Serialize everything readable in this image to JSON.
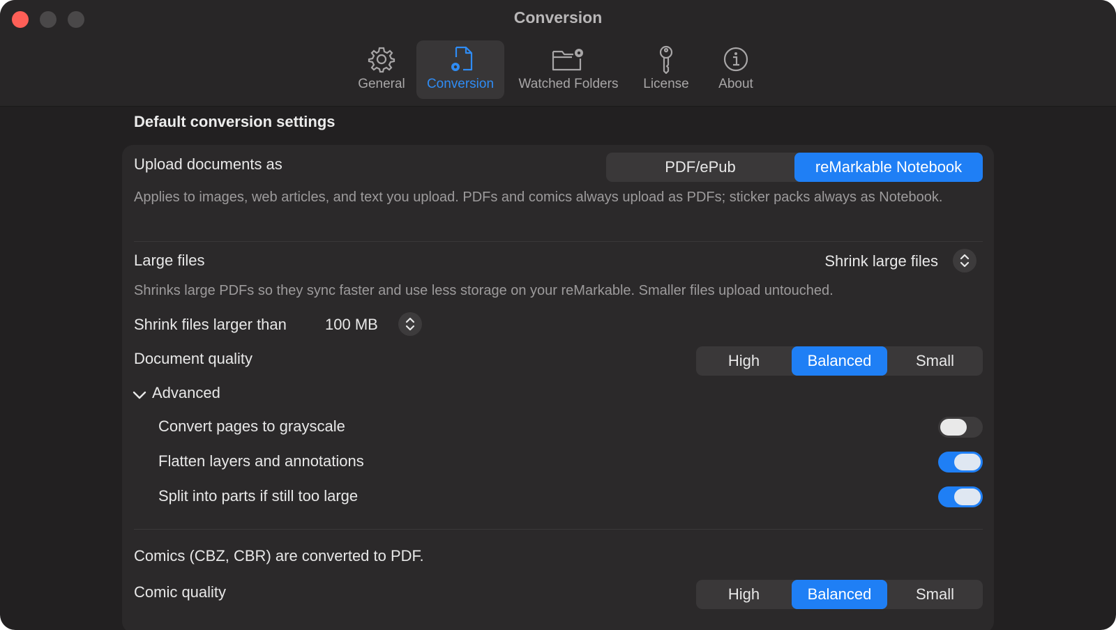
{
  "window": {
    "title": "Conversion"
  },
  "tabs": [
    {
      "label": "General",
      "icon": "gear-icon",
      "active": false
    },
    {
      "label": "Conversion",
      "icon": "document-gear-icon",
      "active": true
    },
    {
      "label": "Watched Folders",
      "icon": "folder-gear-icon",
      "active": false
    },
    {
      "label": "License",
      "icon": "key-icon",
      "active": false
    },
    {
      "label": "About",
      "icon": "info-icon",
      "active": false
    }
  ],
  "section_title": "Default conversion settings",
  "upload": {
    "label": "Upload documents as",
    "options": [
      "PDF/ePub",
      "reMarkable Notebook"
    ],
    "selected": "reMarkable Notebook",
    "description": "Applies to images, web articles, and text you upload. PDFs and comics always upload as PDFs; sticker packs always as Notebook."
  },
  "large_files": {
    "label": "Large files",
    "value": "Shrink large files",
    "description": "Shrinks large PDFs so they sync faster and use less storage on your reMarkable. Smaller files upload untouched.",
    "threshold_label": "Shrink files larger than",
    "threshold_value": "100 MB"
  },
  "document_quality": {
    "label": "Document quality",
    "options": [
      "High",
      "Balanced",
      "Small"
    ],
    "selected": "Balanced"
  },
  "advanced": {
    "label": "Advanced",
    "expanded": true,
    "toggles": [
      {
        "label": "Convert pages to grayscale",
        "on": false
      },
      {
        "label": "Flatten layers and annotations",
        "on": true
      },
      {
        "label": "Split into parts if still too large",
        "on": true
      }
    ]
  },
  "comics": {
    "note": "Comics (CBZ, CBR) are converted to PDF.",
    "label": "Comic quality",
    "options": [
      "High",
      "Balanced",
      "Small"
    ],
    "selected": "Balanced"
  },
  "colors": {
    "accent": "#1f7ff5",
    "window_bg": "#222021",
    "card_bg": "#2b292a"
  }
}
